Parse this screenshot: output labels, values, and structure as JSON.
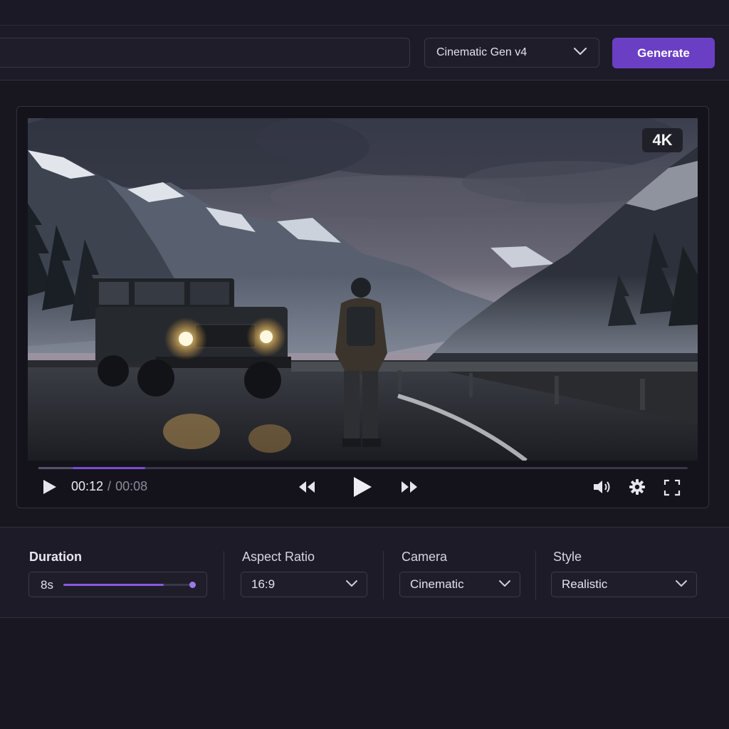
{
  "header": {
    "prompt_value": "",
    "model_select": {
      "selected": "Cinematic Gen v4",
      "icon": "chevron-down-icon"
    },
    "generate_label": "Generate"
  },
  "player": {
    "badge": "4K",
    "time_current": "00:12",
    "time_separator": "/",
    "time_total": "00:08",
    "progress_fraction": 0.165,
    "buffer_fraction": 0.053,
    "icons": [
      "play-icon",
      "rewind-icon",
      "play-icon",
      "fast-forward-icon",
      "volume-icon",
      "gear-icon",
      "fullscreen-icon"
    ]
  },
  "settings": {
    "duration": {
      "label": "Duration",
      "value": "8s",
      "slider_fraction": 0.76
    },
    "aspect_ratio": {
      "label": "Aspect Ratio",
      "value": "16:9"
    },
    "camera": {
      "label": "Camera",
      "value": "Cinematic"
    },
    "style": {
      "label": "Style",
      "value": "Realistic"
    }
  },
  "colors": {
    "accent": "#6b3fc4",
    "progress": "#7c4dd6",
    "background": "#1a1824"
  }
}
